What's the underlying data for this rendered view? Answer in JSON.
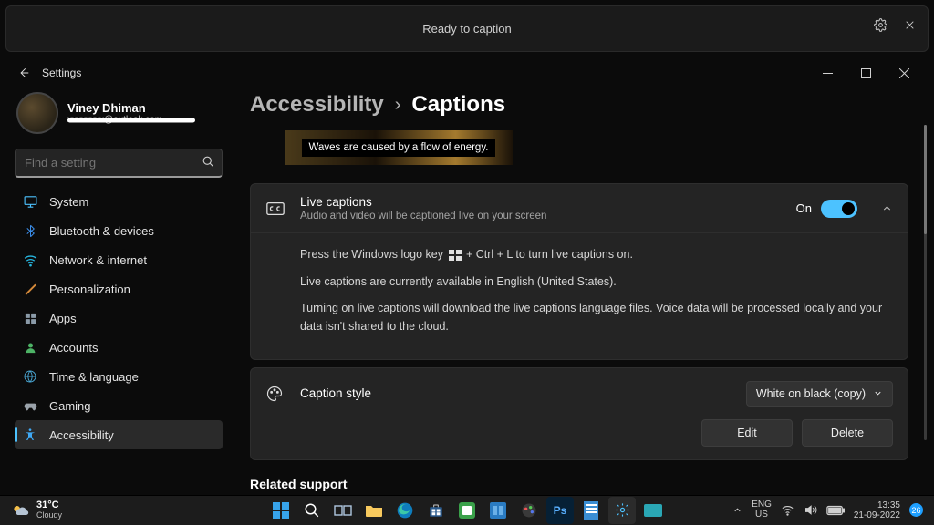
{
  "caption_bar": {
    "message": "Ready to caption"
  },
  "titlebar": {
    "app_title": "Settings"
  },
  "user": {
    "name": "Viney Dhiman",
    "email": "xxxxxxxx@outlook.com"
  },
  "search": {
    "placeholder": "Find a setting"
  },
  "sidebar": {
    "items": [
      {
        "label": "System"
      },
      {
        "label": "Bluetooth & devices"
      },
      {
        "label": "Network & internet"
      },
      {
        "label": "Personalization"
      },
      {
        "label": "Apps"
      },
      {
        "label": "Accounts"
      },
      {
        "label": "Time & language"
      },
      {
        "label": "Gaming"
      },
      {
        "label": "Accessibility"
      }
    ]
  },
  "breadcrumb": {
    "parent": "Accessibility",
    "current": "Captions"
  },
  "preview": {
    "text": "Waves are caused by a flow of energy."
  },
  "live_captions": {
    "title": "Live captions",
    "subtitle": "Audio and video will be captioned live on your screen",
    "state_label": "On",
    "line1_a": "Press the Windows logo key ",
    "line1_b": " + Ctrl + L to turn live captions on.",
    "line2": "Live captions are currently available in English (United States).",
    "line3": "Turning on live captions will download the live captions language files. Voice data will be processed locally and your data isn't shared to the cloud."
  },
  "caption_style": {
    "title": "Caption style",
    "selected": "White on black (copy)",
    "edit": "Edit",
    "delete": "Delete"
  },
  "related": {
    "title": "Related support"
  },
  "taskbar": {
    "weather_temp": "31°C",
    "weather_desc": "Cloudy",
    "lang1": "ENG",
    "lang2": "US",
    "time": "13:35",
    "date": "21-09-2022",
    "notif_count": "26"
  }
}
